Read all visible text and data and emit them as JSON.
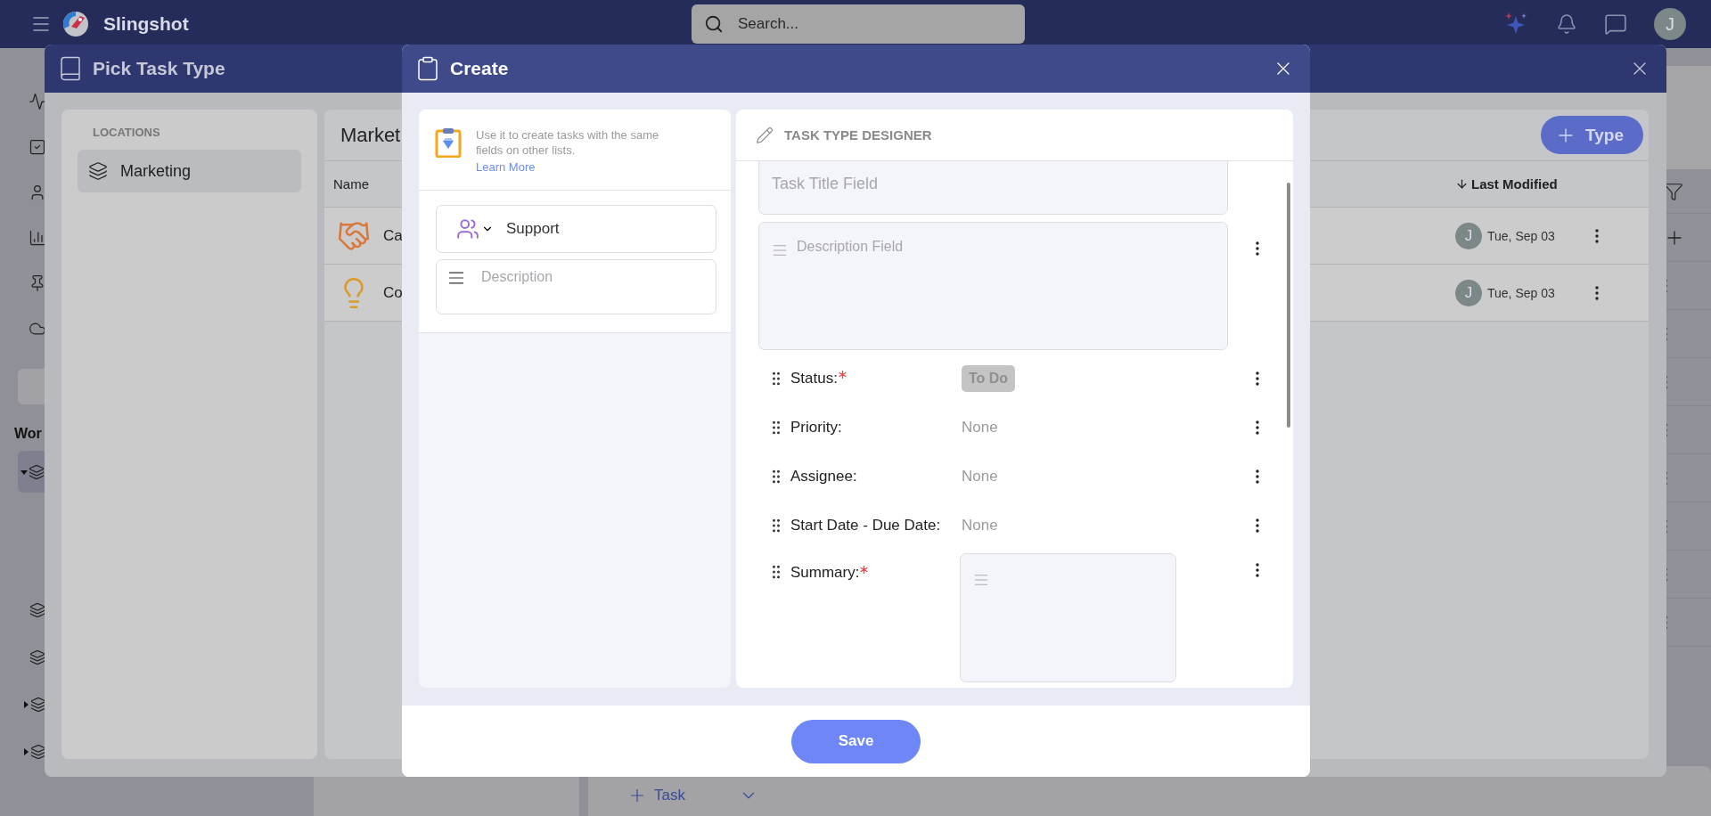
{
  "top_bar": {
    "app_name": "Slingshot",
    "search": {
      "placeholder": "Search..."
    },
    "avatar": "J"
  },
  "background": {
    "section_label": "Wor",
    "tree": [
      {
        "kind": "group",
        "expanded": true,
        "selected": true
      },
      {
        "kind": "list",
        "selected": false
      },
      {
        "kind": "list",
        "selected": false
      },
      {
        "kind": "group",
        "expanded": false,
        "selected": false
      },
      {
        "kind": "group",
        "expanded": false,
        "selected": false
      }
    ],
    "add_task_button": "Task"
  },
  "pick_task_type": {
    "title": "Pick Task Type",
    "locations": {
      "heading": "LOCATIONS",
      "items": [
        {
          "label": "Marketing",
          "selected": true
        }
      ]
    },
    "list": {
      "title": "Market",
      "add_button": "Type",
      "columns": [
        "Name",
        "Last Modified"
      ],
      "rows": [
        {
          "name": "Ca",
          "avatar": "J",
          "modified": "Tue, Sep 03"
        },
        {
          "name": "Co",
          "avatar": "J",
          "modified": "Tue, Sep 03"
        }
      ]
    }
  },
  "create": {
    "title": "Create",
    "info": {
      "text": "Use it to create tasks with the same fields on other lists.",
      "link": "Learn More"
    },
    "name_field": {
      "value": "Support"
    },
    "description_field": {
      "placeholder": "Description"
    },
    "designer": {
      "heading": "TASK TYPE DESIGNER",
      "title_field": {
        "placeholder": "Task Title Field"
      },
      "description_field": {
        "placeholder": "Description Field"
      },
      "fields": [
        {
          "kind": "badge",
          "label": "Status:",
          "required": true,
          "value": "To Do"
        },
        {
          "kind": "text",
          "label": "Priority:",
          "required": false,
          "value": "None"
        },
        {
          "kind": "text",
          "label": "Assignee:",
          "required": false,
          "value": "None"
        },
        {
          "kind": "text",
          "label": "Start Date - Due Date:",
          "required": false,
          "value": "None"
        },
        {
          "kind": "rich_text",
          "label": "Summary:",
          "required": true
        }
      ]
    },
    "save_button": "Save"
  }
}
